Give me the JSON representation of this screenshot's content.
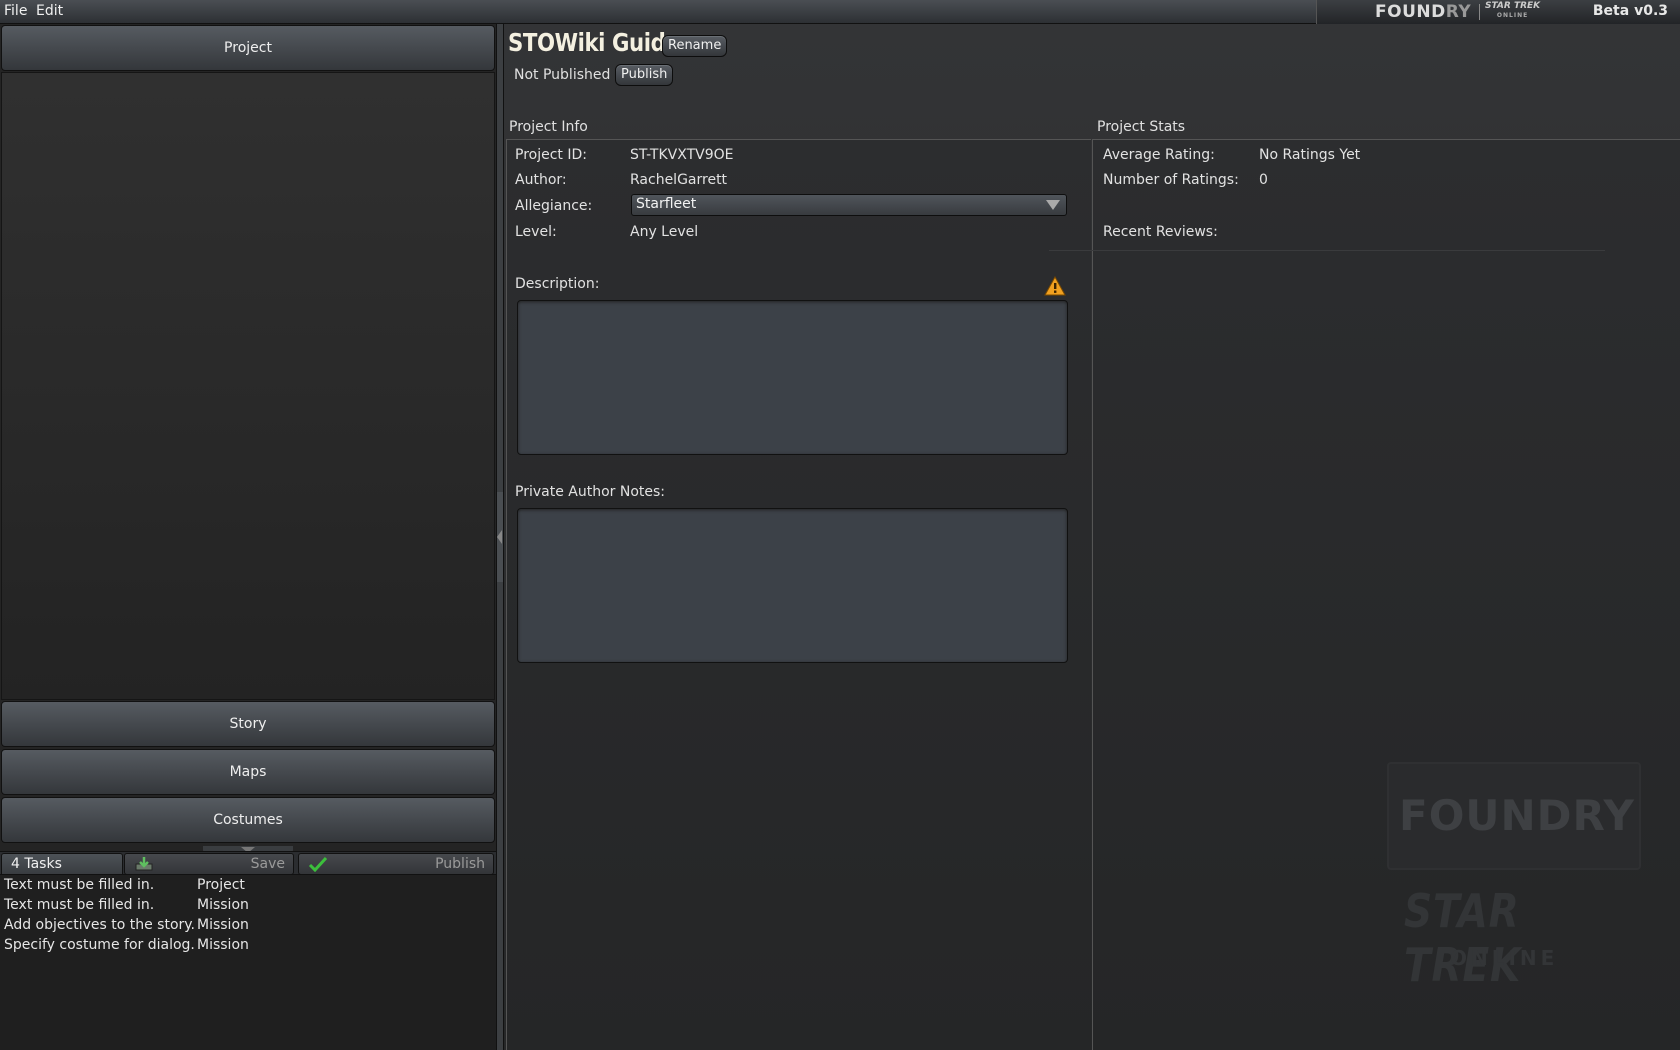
{
  "menu": {
    "file": "File",
    "edit": "Edit"
  },
  "brand": {
    "logo_a": "FOUND",
    "logo_b": "RY",
    "st_line1": "STAR TREK",
    "st_line2": "ONLINE",
    "version": "Beta v0.3"
  },
  "sidebar": {
    "sections": [
      {
        "label": "Project",
        "expanded": true
      },
      {
        "label": "Story",
        "expanded": false
      },
      {
        "label": "Maps",
        "expanded": false
      },
      {
        "label": "Costumes",
        "expanded": false
      }
    ]
  },
  "taskbar": {
    "tasks_label": "4 Tasks",
    "save_label": "Save",
    "publish_label": "Publish",
    "tasks": [
      {
        "text": "Text must be filled in.",
        "scope": "Project"
      },
      {
        "text": "Text must be filled in.",
        "scope": "Mission"
      },
      {
        "text": "Add objectives to the story.",
        "scope": "Mission"
      },
      {
        "text": "Specify costume for dialog.",
        "scope": "Mission"
      }
    ]
  },
  "project": {
    "title": "STOWiki Guide",
    "rename_label": "Rename",
    "status": "Not Published",
    "publish_label": "Publish"
  },
  "info": {
    "section_title": "Project Info",
    "id_label": "Project ID:",
    "id_value": "ST-TKVXTV9OE",
    "author_label": "Author:",
    "author_value": "RachelGarrett",
    "allegiance_label": "Allegiance:",
    "allegiance_value": "Starfleet",
    "level_label": "Level:",
    "level_value": "Any Level",
    "description_label": "Description:",
    "description_value": "",
    "notes_label": "Private Author Notes:",
    "notes_value": ""
  },
  "stats": {
    "section_title": "Project Stats",
    "avg_label": "Average Rating:",
    "avg_value": "No Ratings Yet",
    "num_label": "Number of Ratings:",
    "num_value": "0",
    "reviews_label": "Recent Reviews:"
  },
  "watermark": {
    "foundry": "FOUNDRY",
    "star_trek": "STAR TREK",
    "online": "ONLINE"
  },
  "colors": {
    "background": "#262728",
    "panel": "#2c2d2f",
    "field": "#3c4148",
    "warning": "#f0a020",
    "check": "#3cbf3c"
  }
}
